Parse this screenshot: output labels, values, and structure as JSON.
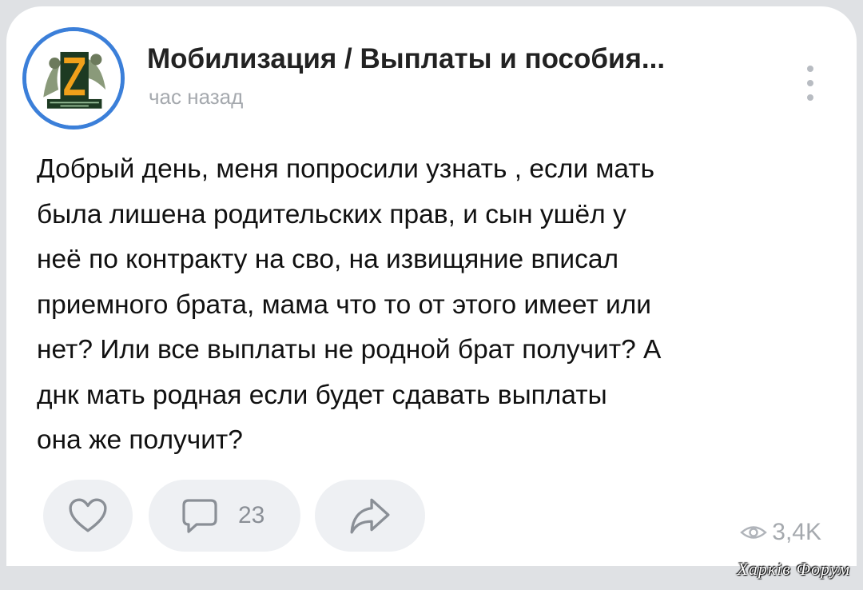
{
  "post": {
    "group_name": "Мобилизация / Выплаты и пособия...",
    "time": "час назад",
    "text_lines": [
      "Добрый день, меня попросили узнать , если мать",
      "была лишена родительских прав, и сын ушёл у",
      "неё по контракту на сво, на извищяние вписал",
      "приемного брата, мама что то от этого имеет или",
      "нет? Или все выплаты не родной брат получит? А",
      "днк мать родная если будет сдавать выплаты",
      "она же получит?"
    ]
  },
  "actions": {
    "like_icon": "heart-icon",
    "comment_icon": "comment-bubble-icon",
    "comment_count": "23",
    "share_icon": "share-arrow-icon"
  },
  "stats": {
    "views_icon": "eye-icon",
    "views_count": "3,4K"
  },
  "watermark": "Харків Форум",
  "colors": {
    "accent_ring": "#3b7fd9",
    "button_bg": "#eef0f3",
    "muted_text": "#a5a9ae"
  }
}
